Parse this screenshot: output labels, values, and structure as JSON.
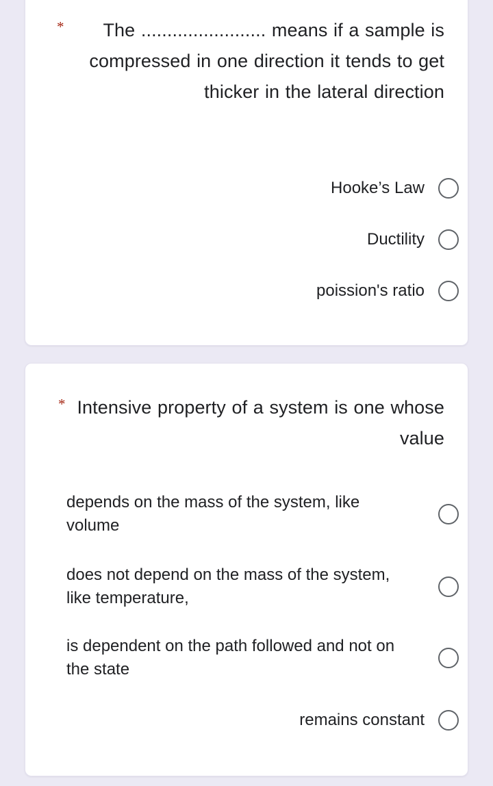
{
  "theme": {
    "page_background": "#ebe9f4",
    "card_background": "#ffffff",
    "text_color": "#202124",
    "required_asterisk_color": "#a52714",
    "radio_border_color": "#5f6368"
  },
  "questions": [
    {
      "required_marker": "*",
      "text": "The ........................ means if a sample is compressed in one direction it tends to get thicker in the lateral direction",
      "text_alignment": "right",
      "options_alignment": "right",
      "options": [
        {
          "label": "Hooke’s Law",
          "selected": false
        },
        {
          "label": "Ductility",
          "selected": false
        },
        {
          "label": "poission's ratio",
          "selected": false
        }
      ]
    },
    {
      "required_marker": "*",
      "text": "Intensive property of a system is one whose value",
      "text_alignment": "right",
      "options_alignment": "left",
      "options": [
        {
          "label": "depends on the mass of the system, like volume",
          "selected": false
        },
        {
          "label": "does not depend on the mass of the system, like temperature,",
          "selected": false
        },
        {
          "label": "is dependent on the path followed and not on the state",
          "selected": false
        },
        {
          "label": "remains constant",
          "selected": false,
          "alignment": "right"
        }
      ]
    }
  ]
}
